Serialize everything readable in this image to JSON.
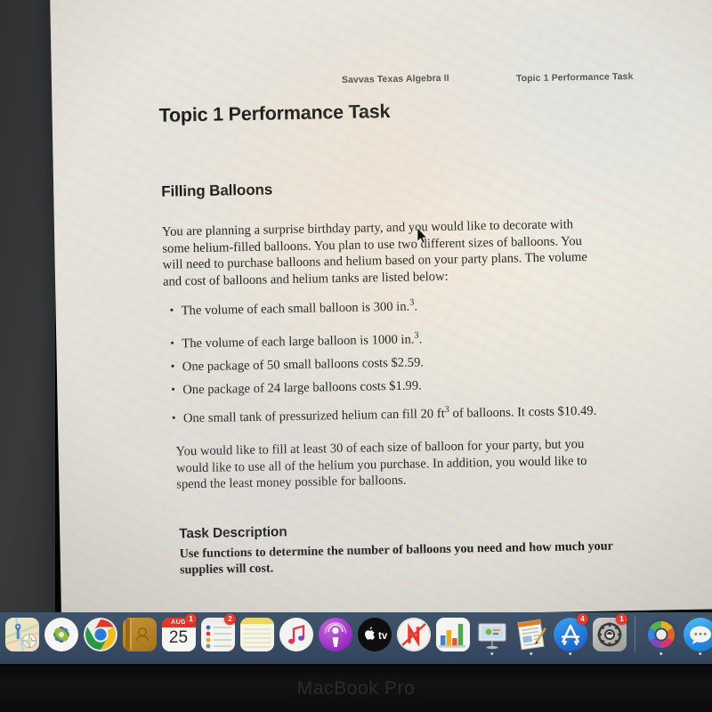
{
  "device": {
    "brand_label": "MacBook Pro"
  },
  "document": {
    "running_head_left": "Savvas Texas Algebra II",
    "running_head_right": "Topic 1 Performance Task",
    "title": "Topic 1 Performance Task",
    "section_title": "Filling Balloons",
    "intro_paragraph": "You are planning a surprise birthday party, and you would like to decorate with some helium-filled balloons. You plan to use two different sizes of balloons. You will need to purchase balloons and helium based on your party plans. The volume and cost of balloons and helium tanks are listed below:",
    "bullets": [
      "The volume of each small balloon is 300 in.",
      "The volume of each large balloon is 1000 in.",
      "One package of 50 small balloons costs $2.59.",
      "One package of 24 large balloons costs $1.99.",
      "One small tank of pressurized helium can fill 20 ft"
    ],
    "bullet_superscripts": [
      "3",
      "3",
      "",
      "",
      "3"
    ],
    "bullet_tails": [
      ".",
      ".",
      "",
      "",
      " of balloons. It costs $10.49."
    ],
    "closing_paragraph": "You would like to fill at least 30 of each size of balloon for your party, but you would like to use all of the helium you purchase. In addition, you would like to spend the least money possible for balloons.",
    "task_heading": "Task Description",
    "task_body": "Use functions to determine the number of balloons you need and how much your supplies will cost."
  },
  "dock": {
    "items": [
      {
        "name": "maps",
        "label": "Maps",
        "badge": "",
        "running": false
      },
      {
        "name": "photos",
        "label": "Photos",
        "badge": "",
        "running": false
      },
      {
        "name": "google-chrome",
        "label": "Google Chrome",
        "badge": "",
        "running": true
      },
      {
        "name": "contacts",
        "label": "Contacts",
        "badge": "",
        "running": false
      },
      {
        "name": "calendar",
        "label": "Calendar",
        "badge": "1",
        "running": false
      },
      {
        "name": "reminders",
        "label": "Reminders",
        "badge": "2",
        "running": false
      },
      {
        "name": "notes",
        "label": "Notes",
        "badge": "",
        "running": false
      },
      {
        "name": "music",
        "label": "Music",
        "badge": "",
        "running": false
      },
      {
        "name": "podcasts",
        "label": "Podcasts",
        "badge": "",
        "running": false
      },
      {
        "name": "apple-tv",
        "label": "TV",
        "badge": "",
        "running": false
      },
      {
        "name": "news",
        "label": "News",
        "badge": "",
        "running": false
      },
      {
        "name": "numbers",
        "label": "Numbers",
        "badge": "",
        "running": false
      },
      {
        "name": "keynote",
        "label": "Keynote",
        "badge": "",
        "running": true
      },
      {
        "name": "pages",
        "label": "Pages",
        "badge": "",
        "running": true
      },
      {
        "name": "app-store",
        "label": "App Store",
        "badge": "4",
        "running": true
      },
      {
        "name": "system-preferences",
        "label": "System Preferences",
        "badge": "1",
        "running": false
      },
      {
        "name": "photos-app",
        "label": "Photos",
        "badge": "",
        "running": true
      },
      {
        "name": "messages",
        "label": "Messages",
        "badge": "",
        "running": true
      }
    ],
    "calendar": {
      "month": "AUG",
      "day": "25"
    }
  },
  "colors": {
    "dock_bg": "#3b4e66",
    "badge_red": "#e8392f",
    "page_bg": "#e6e2da",
    "bezel": "#313234"
  }
}
